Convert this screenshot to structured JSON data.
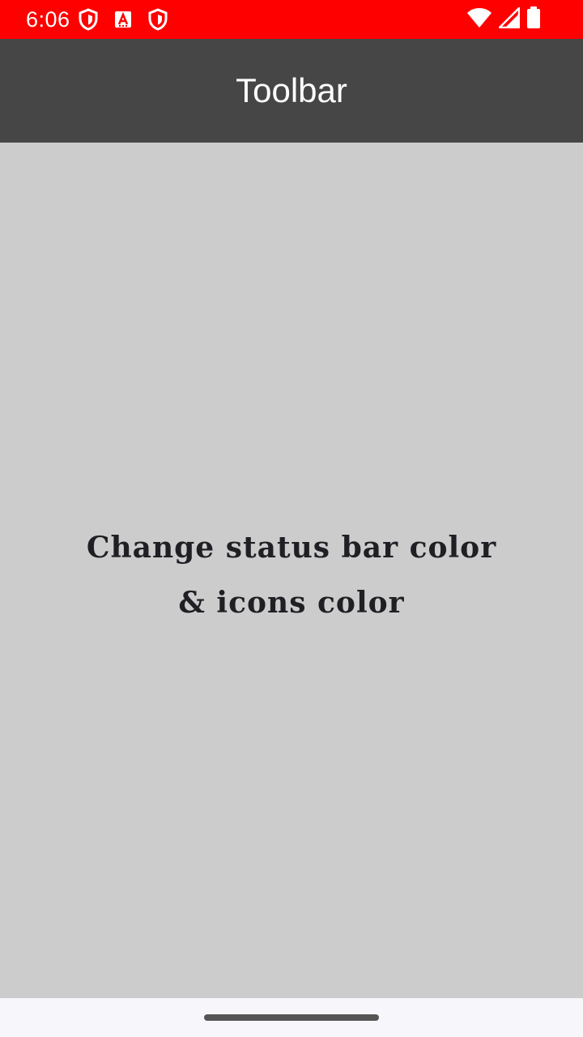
{
  "status_bar": {
    "time": "6:06",
    "background_color": "#ff0000",
    "left_icons": [
      "shield-icon",
      "font-app-icon",
      "shield-icon"
    ],
    "right_icons": [
      "wifi-icon",
      "cell-signal-icon",
      "battery-icon"
    ]
  },
  "toolbar": {
    "title": "Toolbar",
    "background_color": "#464646"
  },
  "content": {
    "background_color": "#cccccc",
    "message_line1": "Change status bar color",
    "message_line2": "& icons color"
  },
  "nav_bar": {
    "background_color": "#f7f6fb",
    "handle_color": "#555555",
    "handle": "gesture-handle"
  }
}
